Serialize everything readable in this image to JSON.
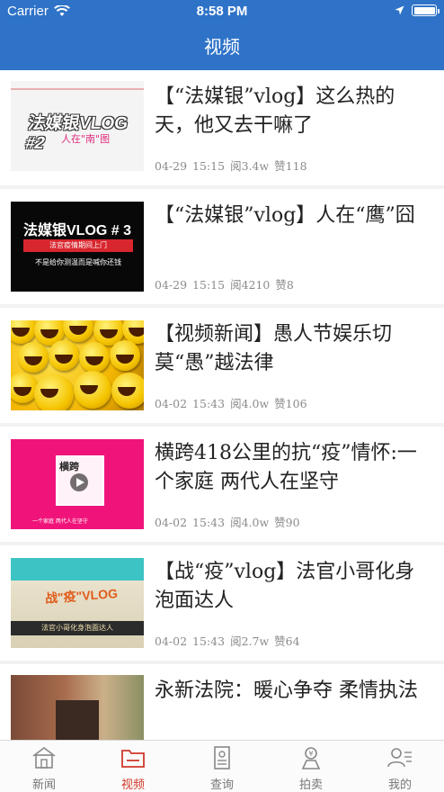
{
  "status_bar": {
    "carrier": "Carrier",
    "time": "8:58 PM"
  },
  "header": {
    "title": "视频"
  },
  "items": [
    {
      "title": "【“法媒银”vlog】这么热的天，他又去干嘛了",
      "date": "04-29",
      "time": "15:15",
      "reads": "阅3.4w",
      "likes": "赞118",
      "thumb": {
        "big": "法媒银VLOG",
        "num": "#2",
        "sub": "人在\"南\"图"
      }
    },
    {
      "title": "【“法媒银”vlog】人在“鹰”囧",
      "date": "04-29",
      "time": "15:15",
      "reads": "阅4210",
      "likes": "赞8",
      "thumb": {
        "big": "法媒银VLOG # 3",
        "bar": "法官疫情期间上门",
        "small": "不是给你测温而是喊你还钱"
      }
    },
    {
      "title": "【视频新闻】愚人节娱乐切莫“愚”越法律",
      "date": "04-02",
      "time": "15:43",
      "reads": "阅4.0w",
      "likes": "赞106"
    },
    {
      "title": "横跨418公里的抗“疫”情怀:一个家庭 两代人在坚守",
      "date": "04-02",
      "time": "15:43",
      "reads": "阅4.0w",
      "likes": "赞90",
      "thumb": {
        "w1": "横跨",
        "bot": "一个家庭  两代人在坚守"
      }
    },
    {
      "title": "【战“疫”vlog】法官小哥化身泡面达人",
      "date": "04-02",
      "time": "15:43",
      "reads": "阅2.7w",
      "likes": "赞64",
      "thumb": {
        "big": "战\"疫\"VLOG",
        "strip": "法官小哥化身泡面达人"
      }
    },
    {
      "title": "永新法院：暖心争夺 柔情执法",
      "date": "",
      "time": "",
      "reads": "",
      "likes": ""
    }
  ],
  "tabs": [
    {
      "label": "新闻",
      "icon": "home-icon",
      "active": false
    },
    {
      "label": "视频",
      "icon": "video-folder-icon",
      "active": true
    },
    {
      "label": "查询",
      "icon": "document-icon",
      "active": false
    },
    {
      "label": "拍卖",
      "icon": "auction-icon",
      "active": false
    },
    {
      "label": "我的",
      "icon": "profile-icon",
      "active": false
    }
  ],
  "colors": {
    "header_bg": "#2f73c8",
    "active_tab": "#d0392b",
    "inactive_tab": "#777777"
  }
}
